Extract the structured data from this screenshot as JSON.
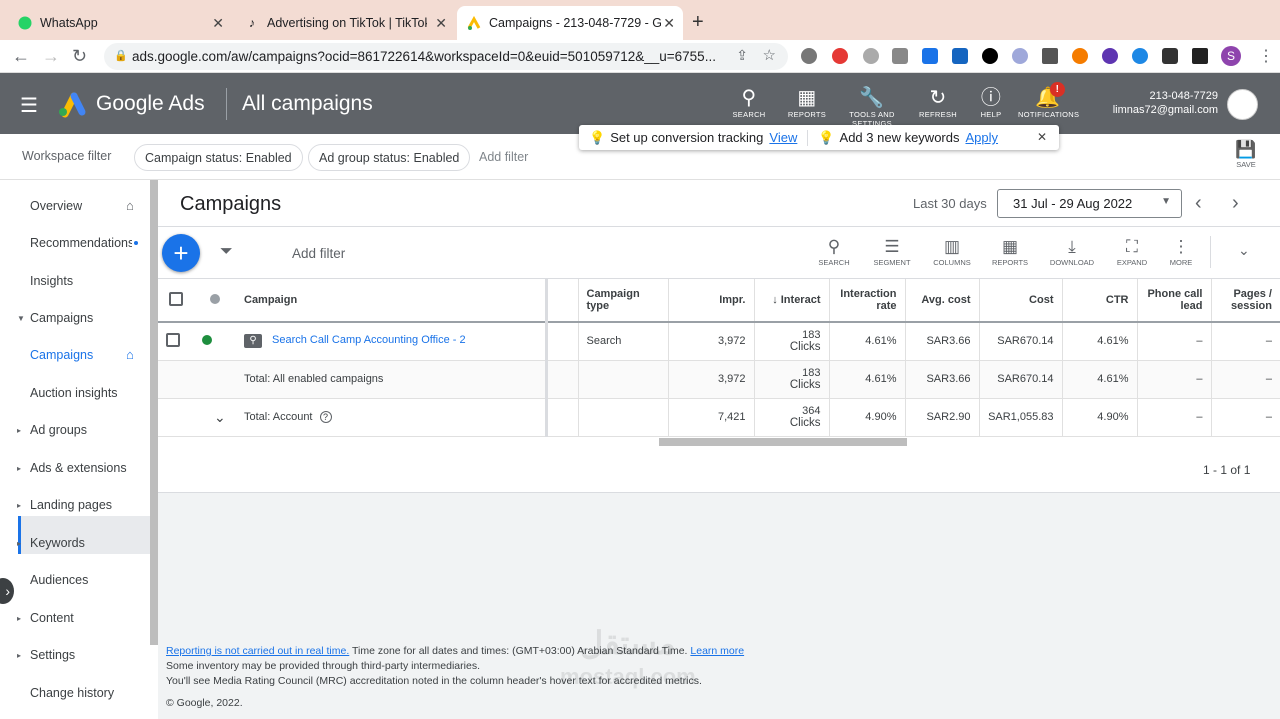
{
  "browser": {
    "tabs": [
      {
        "title": "WhatsApp",
        "icon": "whatsapp-icon",
        "active": false
      },
      {
        "title": "Advertising on TikTok | TikTok",
        "icon": "tiktok-icon",
        "active": false
      },
      {
        "title": "Campaigns - 213-048-7729 - G",
        "icon": "google-ads-icon",
        "active": true
      }
    ],
    "url": "ads.google.com/aw/campaigns?ocid=861722614&workspaceId=0&euid=501059712&__u=6755...",
    "profile_initial": "S"
  },
  "header": {
    "brand": "Google Ads",
    "title": "All campaigns",
    "buttons": [
      {
        "label": "SEARCH",
        "icon": "search-icon"
      },
      {
        "label": "REPORTS",
        "icon": "reports-icon"
      },
      {
        "label": "TOOLS AND SETTINGS",
        "icon": "wrench-icon"
      },
      {
        "label": "REFRESH",
        "icon": "refresh-icon"
      },
      {
        "label": "HELP",
        "icon": "help-icon"
      },
      {
        "label": "NOTIFICATIONS",
        "icon": "bell-icon"
      }
    ],
    "notification_badge": "!",
    "account_id": "213-048-7729",
    "account_email": "limnas72@gmail.com"
  },
  "filterbar": {
    "label": "Workspace filter",
    "chips": [
      "Campaign status: Enabled",
      "Ad group status: Enabled"
    ],
    "add_filter": "Add filter",
    "save": "SAVE"
  },
  "banner": {
    "item1_text": "Set up conversion tracking",
    "item1_link": "View",
    "item2_text": "Add 3 new keywords",
    "item2_link": "Apply"
  },
  "sidebar": {
    "items": [
      {
        "label": "Overview"
      },
      {
        "label": "Recommendations"
      },
      {
        "label": "Insights"
      },
      {
        "label": "Campaigns"
      },
      {
        "label": "Campaigns"
      },
      {
        "label": "Auction insights"
      },
      {
        "label": "Ad groups"
      },
      {
        "label": "Ads & extensions"
      },
      {
        "label": "Landing pages"
      },
      {
        "label": "Keywords"
      },
      {
        "label": "Audiences"
      },
      {
        "label": "Content"
      },
      {
        "label": "Settings"
      },
      {
        "label": "Change history"
      }
    ]
  },
  "main": {
    "title": "Campaigns",
    "range_label": "Last 30 days",
    "range_value": "31 Jul - 29 Aug 2022",
    "add_filter": "Add filter",
    "tools": [
      "SEARCH",
      "SEGMENT",
      "COLUMNS",
      "REPORTS",
      "DOWNLOAD",
      "EXPAND",
      "MORE"
    ],
    "columns": [
      "Campaign",
      "Campaign type",
      "Impr.",
      "Interact",
      "Interaction rate",
      "Avg. cost",
      "Cost",
      "CTR",
      "Phone call lead",
      "Pages / session"
    ],
    "rows": [
      {
        "campaign": "Search Call Camp Accounting Office - 2",
        "type": "Search",
        "impr": "3,972",
        "inter_n": "183",
        "inter_u": "Clicks",
        "rate": "4.61%",
        "avg": "SAR3.66",
        "cost": "SAR670.14",
        "ctr": "4.61%",
        "phone": "–",
        "pages": "–"
      }
    ],
    "total_enabled": {
      "label": "Total: All enabled campaigns",
      "impr": "3,972",
      "inter_n": "183",
      "inter_u": "Clicks",
      "rate": "4.61%",
      "avg": "SAR3.66",
      "cost": "SAR670.14",
      "ctr": "4.61%",
      "phone": "–",
      "pages": "–"
    },
    "total_account": {
      "label": "Total: Account",
      "impr": "7,421",
      "inter_n": "364",
      "inter_u": "Clicks",
      "rate": "4.90%",
      "avg": "SAR2.90",
      "cost": "SAR1,055.83",
      "ctr": "4.90%",
      "phone": "–",
      "pages": "–"
    },
    "pager": "1 - 1 of 1"
  },
  "footer": {
    "link1": "Reporting is not carried out in real time.",
    "text1": " Time zone for all dates and times: (GMT+03:00) Arabian Standard Time. ",
    "link2": "Learn more",
    "line2": "Some inventory may be provided through third-party intermediaries.",
    "line3": "You'll see Media Rating Council (MRC) accreditation noted in the column header's hover text for accredited metrics.",
    "copyright": "© Google, 2022."
  },
  "watermark": "مستقل mostaql.com",
  "colors": {
    "accent": "#1a73e8",
    "header": "#5f6368",
    "status_enabled": "#1e8e3e"
  }
}
